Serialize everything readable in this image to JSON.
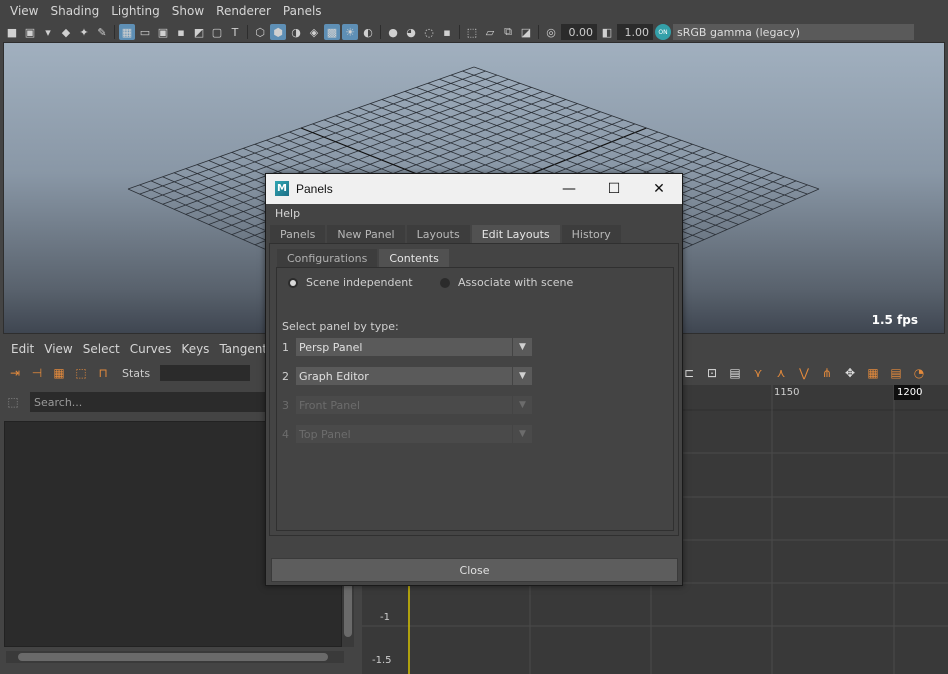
{
  "viewport": {
    "menu": [
      "View",
      "Shading",
      "Lighting",
      "Show",
      "Renderer",
      "Panels"
    ],
    "toolbar": {
      "exposure_value": "0.00",
      "gamma_value": "1.00",
      "color_space": "sRGB gamma (legacy)"
    },
    "fps": "1.5 fps"
  },
  "graph_editor": {
    "menu": [
      "Edit",
      "View",
      "Select",
      "Curves",
      "Keys",
      "Tangents"
    ],
    "stats_label": "Stats",
    "search_placeholder": "Search...",
    "x_ticks": [
      "1150",
      "1200"
    ],
    "y_ticks": [
      "-1",
      "-1.5"
    ],
    "current_frame": "1200"
  },
  "dialog": {
    "title": "Panels",
    "menu": "Help",
    "tabs": [
      "Panels",
      "New Panel",
      "Layouts",
      "Edit Layouts",
      "History"
    ],
    "active_tab": "Edit Layouts",
    "subtabs": [
      "Configurations",
      "Contents"
    ],
    "active_subtab": "Contents",
    "radio_scene_independent": "Scene independent",
    "radio_associate": "Associate with scene",
    "selected_radio": "Scene independent",
    "select_label": "Select panel by type:",
    "panels": [
      {
        "num": "1",
        "value": "Persp Panel",
        "enabled": true
      },
      {
        "num": "2",
        "value": "Graph Editor",
        "enabled": true
      },
      {
        "num": "3",
        "value": "Front Panel",
        "enabled": false
      },
      {
        "num": "4",
        "value": "Top Panel",
        "enabled": false
      }
    ],
    "close_label": "Close"
  }
}
